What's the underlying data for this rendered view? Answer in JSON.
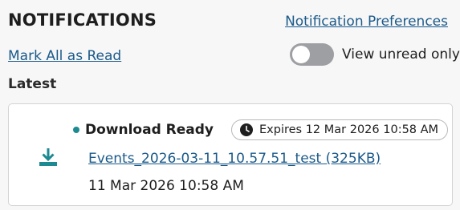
{
  "header": {
    "title": "NOTIFICATIONS",
    "preferences_link": "Notification Preferences",
    "mark_all_read": "Mark All as Read",
    "view_unread_label": "View unread only",
    "view_unread_on": false
  },
  "section": {
    "label": "Latest"
  },
  "notifications": [
    {
      "status": "Download Ready",
      "unread": true,
      "expires": "Expires 12 Mar 2026 10:58 AM",
      "file_link": "Events_2026-03-11_10.57.51_test (325KB)",
      "timestamp": "11 Mar 2026 10:58 AM",
      "icon": "download-icon"
    }
  ],
  "colors": {
    "link": "#1b5a8a",
    "accent": "#1d8a92",
    "toggle_off": "#9e9fa3"
  }
}
